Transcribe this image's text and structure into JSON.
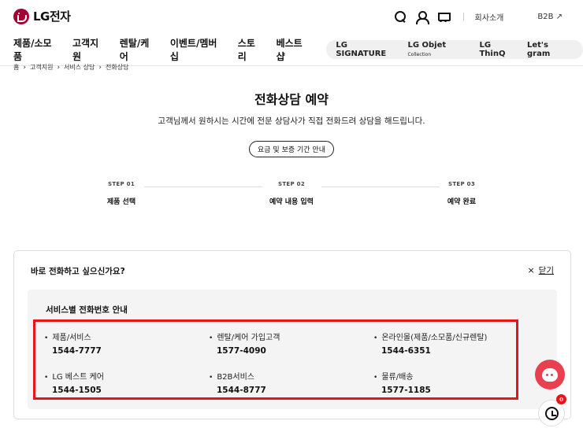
{
  "header": {
    "logo_text": "LG전자",
    "company_link": "회사소개",
    "b2b_link": "B2B ↗"
  },
  "gnb": {
    "menus": [
      "제품/소모품",
      "고객지원",
      "렌탈/케어",
      "이벤트/멤버십",
      "스토리",
      "베스트샵"
    ],
    "brands": {
      "signature": "LG SIGNATURE",
      "objet": "LG Objet",
      "objet_small": "Collection",
      "thinq": "LG ThinQ",
      "gram": "Let's gram"
    }
  },
  "breadcrumb": [
    "홈",
    "고객지원",
    "서비스 상담",
    "전화상담"
  ],
  "page": {
    "title": "전화상담 예약",
    "subtitle": "고객님께서 원하시는 시간에 전문 상담사가 직접 전화드려 상담을 해드립니다.",
    "fee_button": "요금 및 보증 기간 안내"
  },
  "steps": [
    {
      "num": "STEP 01",
      "label": "제품 선택"
    },
    {
      "num": "STEP 02",
      "label": "예약 내용 입력"
    },
    {
      "num": "STEP 03",
      "label": "예약 완료"
    }
  ],
  "panel": {
    "question": "바로 전화하고 싶으신가요?",
    "close_label": "닫기",
    "info_title": "서비스별 전화번호 안내",
    "phones": [
      {
        "name": "제품/서비스",
        "number": "1544-7777"
      },
      {
        "name": "렌탈/케어 가입고객",
        "number": "1577-4090"
      },
      {
        "name": "온라인몰(제품/소모품/신규렌탈)",
        "number": "1544-6351"
      },
      {
        "name": "LG 베스트 케어",
        "number": "1544-1505"
      },
      {
        "name": "B2B서비스",
        "number": "1544-8777"
      },
      {
        "name": "물류/배송",
        "number": "1577-1185"
      }
    ]
  },
  "floating": {
    "history_badge": "0"
  },
  "colors": {
    "brand": "#a50034",
    "highlight": "#e4161c",
    "chat": "#e8404f"
  }
}
